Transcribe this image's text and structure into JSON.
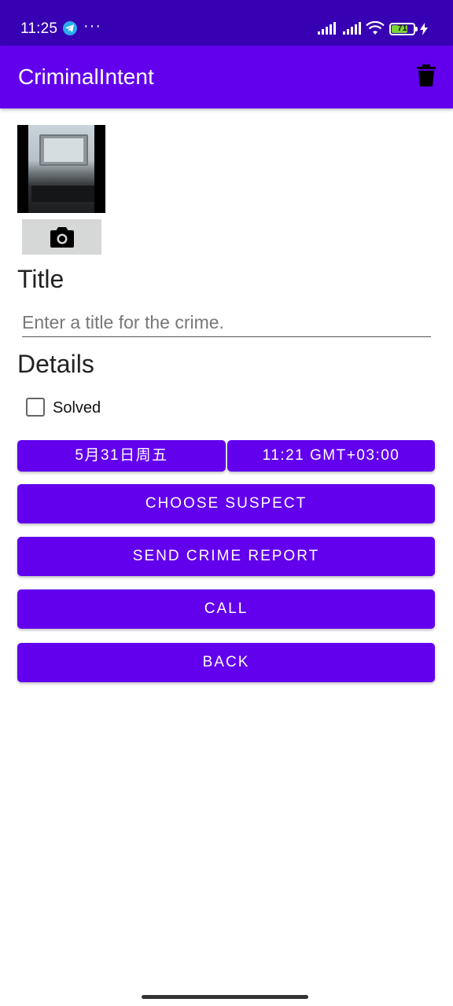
{
  "status_bar": {
    "time": "11:25",
    "notification_icons": [
      "telegram-icon",
      "more-dots-icon"
    ],
    "dots": "···",
    "battery_level": "71",
    "bg_color": "#3700b3"
  },
  "app_bar": {
    "title": "CriminalIntent",
    "action_icon": "delete-icon",
    "bg_color": "#6200ee"
  },
  "photo": {
    "camera_icon": "camera-icon"
  },
  "form": {
    "title_label": "Title",
    "title_placeholder": "Enter a title for the crime.",
    "title_value": "",
    "details_label": "Details",
    "solved_label": "Solved",
    "solved_checked": false
  },
  "buttons": {
    "date": "5月31日周五",
    "time": "11:21 GMT+03:00",
    "choose_suspect": "CHOOSE SUSPECT",
    "send_report": "SEND CRIME REPORT",
    "call": "CALL",
    "back": "BACK",
    "accent": "#6200ee"
  }
}
